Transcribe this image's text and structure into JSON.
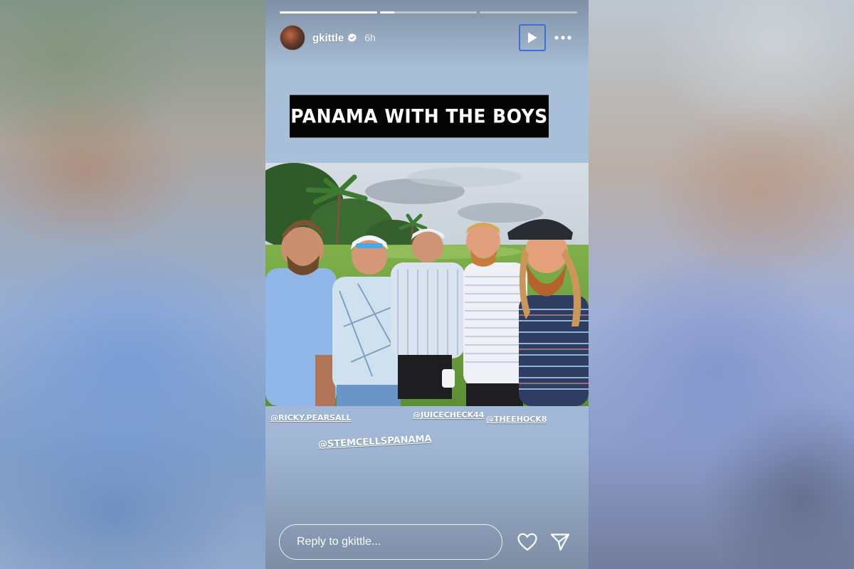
{
  "story": {
    "progress_fills": [
      1.0,
      0.15,
      0.0
    ],
    "user": {
      "username": "gkittle",
      "verified": true,
      "time_ago": "6h"
    },
    "caption": "PANAMA WITH THE BOYS",
    "mentions": {
      "m1": "@RICKY.PEARSALL",
      "m2": "@JUICECHECK44",
      "m3": "@THEEHOCK8",
      "m4": "@STEMCELLSPANAMA"
    },
    "reply": {
      "placeholder": "Reply to gkittle..."
    }
  },
  "icons": {
    "play": "play-icon",
    "more": "more-horizontal-icon",
    "like": "heart-icon",
    "share": "send-icon"
  },
  "colors": {
    "focus_ring": "#3d6fd8",
    "caption_bg": "#050505"
  }
}
